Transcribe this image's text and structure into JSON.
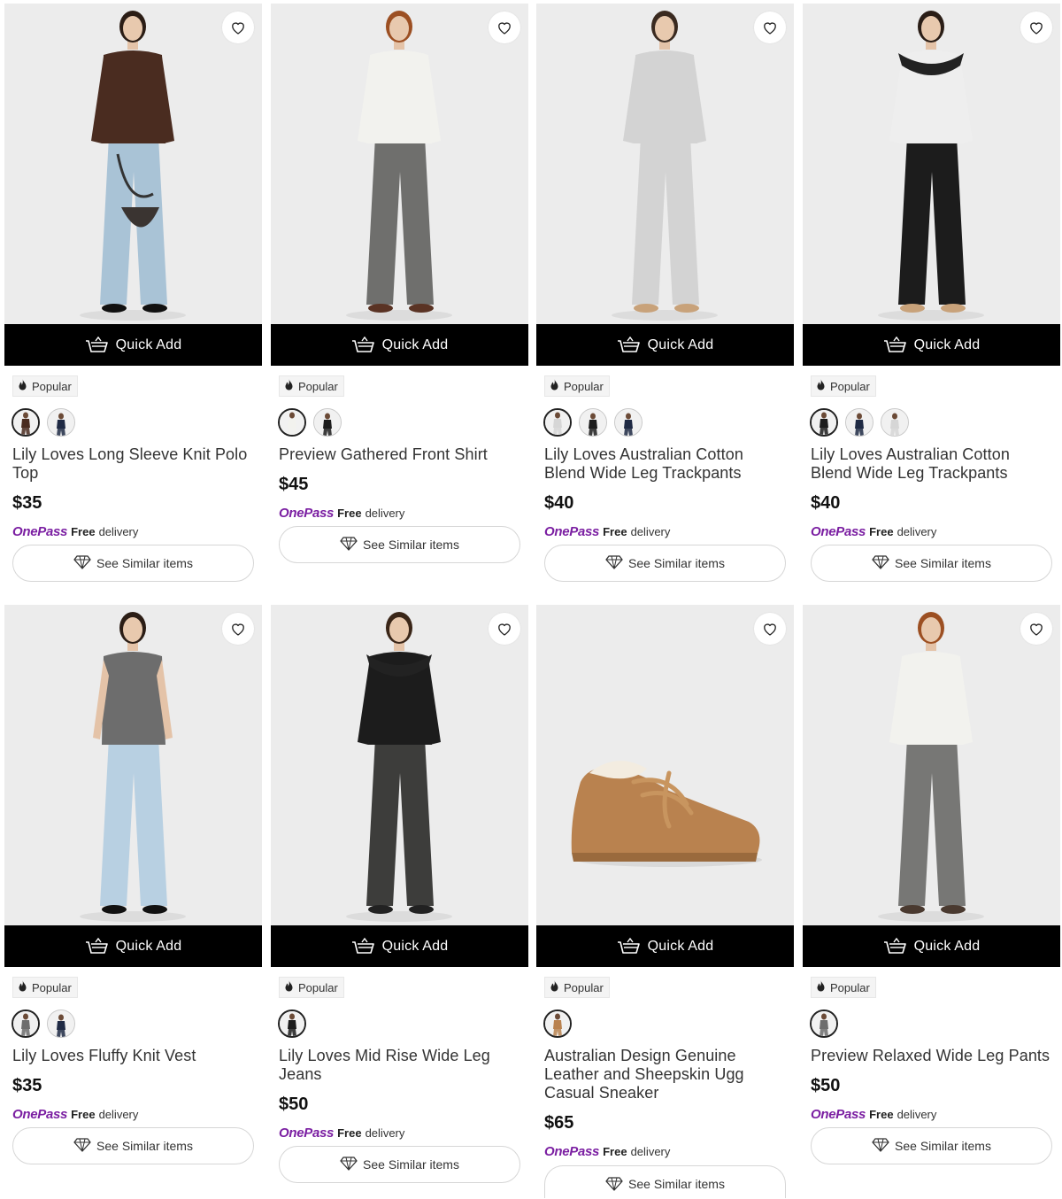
{
  "brand": {
    "onepass_label": "OnePass",
    "onepass_color": "#7b1fa2"
  },
  "common": {
    "quick_add_label": "Quick Add",
    "popular_label": "Popular",
    "free_label": "Free",
    "delivery_label": "delivery",
    "see_similar_label": "See Similar items"
  },
  "products": [
    {
      "name": "Lily Loves Long Sleeve Knit Polo Top",
      "price": "$35",
      "image": "model-brown-polo-light-jeans",
      "swatches": [
        "brown",
        "navy"
      ]
    },
    {
      "name": "Preview Gathered Front Shirt",
      "price": "$45",
      "image": "model-white-shirt-grey-pants",
      "swatches": [
        "white",
        "black"
      ]
    },
    {
      "name": "Lily Loves Australian Cotton Blend Wide Leg Trackpants",
      "price": "$40",
      "image": "model-grey-hoodie-trackpants",
      "swatches": [
        "light-grey",
        "black",
        "navy"
      ]
    },
    {
      "name": "Lily Loves Australian Cotton Blend Wide Leg Trackpants",
      "price": "$40",
      "image": "model-black-trackpants",
      "swatches": [
        "black",
        "navy",
        "light-grey"
      ]
    },
    {
      "name": "Lily Loves Fluffy Knit Vest",
      "price": "$35",
      "image": "model-grey-knit-vest",
      "swatches": [
        "grey",
        "navy"
      ]
    },
    {
      "name": "Lily Loves Mid Rise Wide Leg Jeans",
      "price": "$50",
      "image": "model-black-wide-jeans",
      "swatches": [
        "black"
      ]
    },
    {
      "name": "Australian Design Genuine Leather and Sheepskin Ugg Casual Sneaker",
      "price": "$65",
      "image": "tan-sheepskin-sneaker",
      "swatches": [
        "tan"
      ]
    },
    {
      "name": "Preview Relaxed Wide Leg Pants",
      "price": "$50",
      "image": "model-white-shirt-grey-pants",
      "swatches": [
        "grey"
      ]
    }
  ],
  "colors": {
    "brown": "#4a2c20",
    "navy": "#1f2a44",
    "white": "#f2f2ee",
    "black": "#1c1c1c",
    "light-grey": "#d6d6d6",
    "grey": "#6d6d6d",
    "tan": "#b9824f"
  }
}
